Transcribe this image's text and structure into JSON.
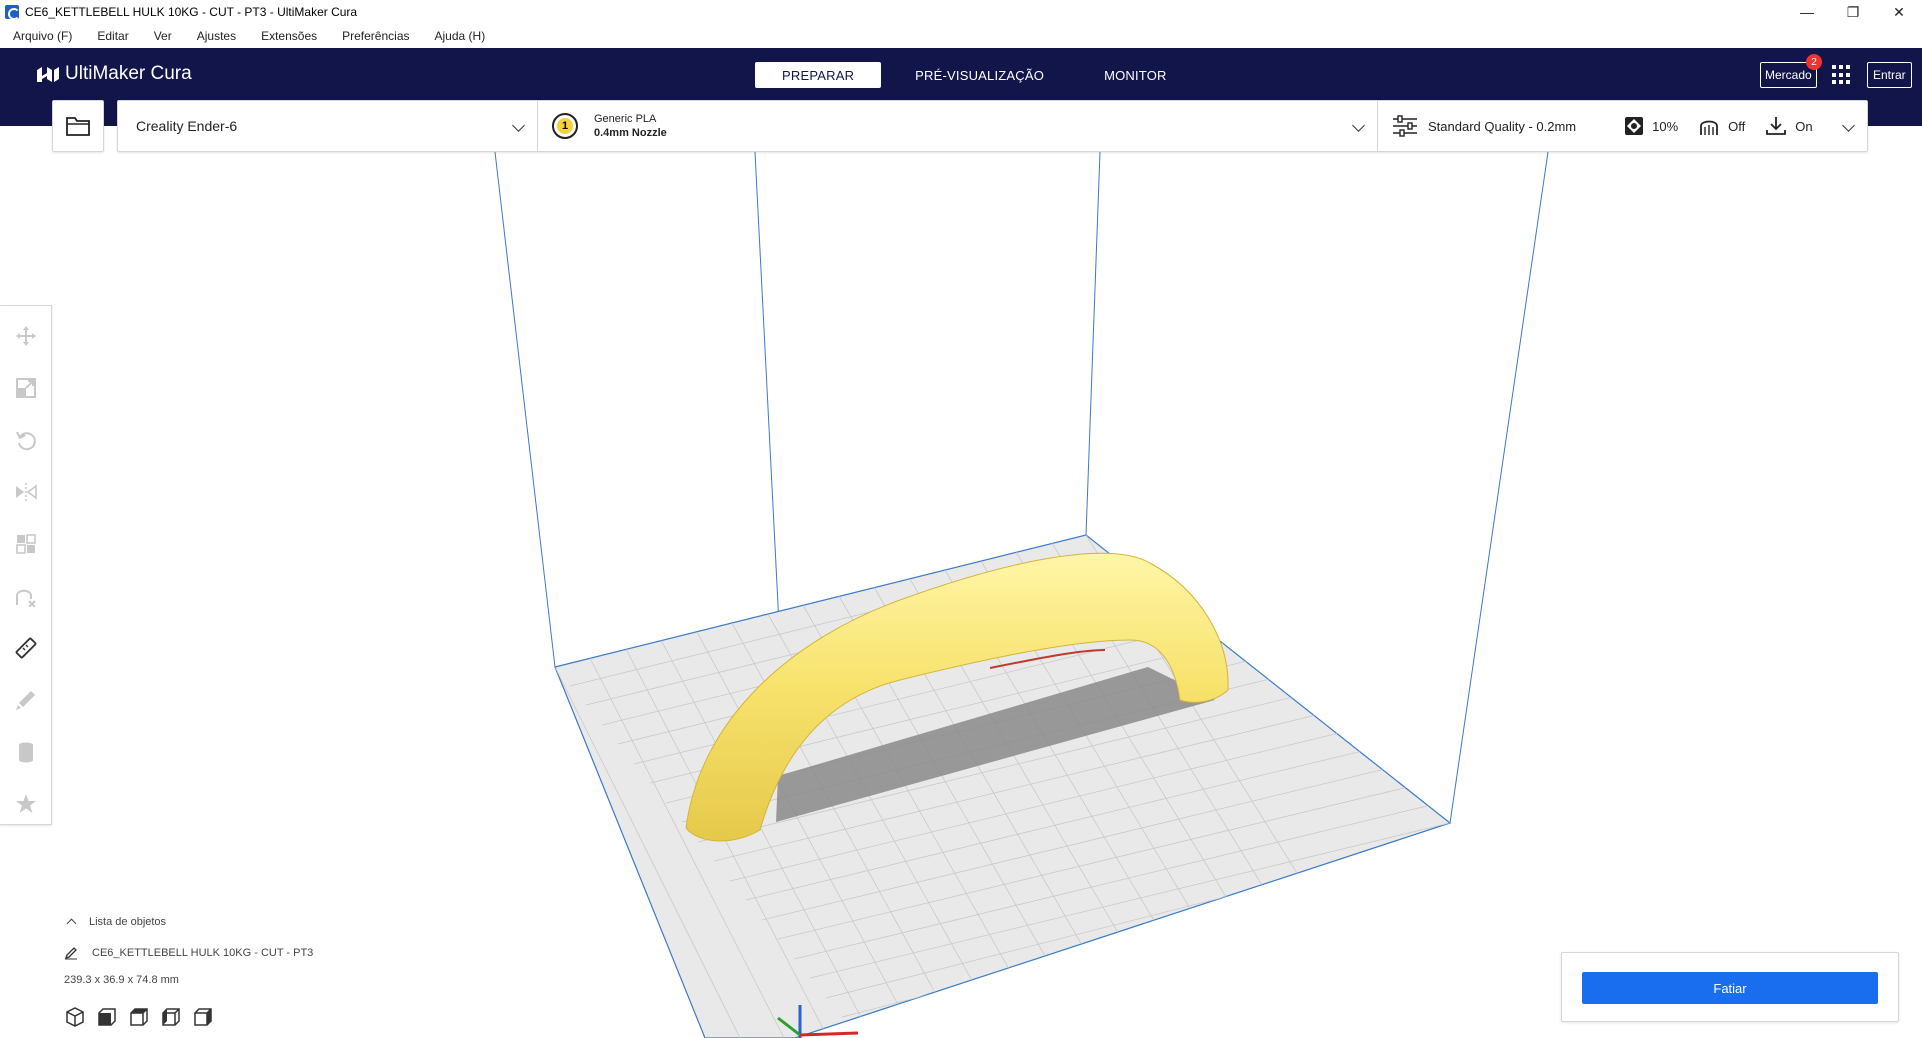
{
  "window": {
    "title": "CE6_KETTLEBELL HULK 10KG - CUT - PT3 - UltiMaker Cura",
    "minimize": "—",
    "restore": "❐",
    "close": "✕"
  },
  "menu": [
    "Arquivo (F)",
    "Editar",
    "Ver",
    "Ajustes",
    "Extensões",
    "Preferências",
    "Ajuda (H)"
  ],
  "header": {
    "brand": "UltiMaker Cura",
    "tabs": [
      "PREPARAR",
      "PRÉ-VISUALIZAÇÃO",
      "MONITOR"
    ],
    "active_tab": "PREPARAR",
    "marketplace_label": "Mercado",
    "marketplace_badge": "2",
    "signin_label": "Entrar"
  },
  "config": {
    "printer": "Creality Ender-6",
    "extruder_number": "1",
    "material": "Generic PLA",
    "nozzle": "0.4mm Nozzle",
    "quality": "Standard Quality - 0.2mm",
    "infill": "10%",
    "support": "Off",
    "adhesion": "On"
  },
  "object_list": {
    "title": "Lista de objetos",
    "object_name": "CE6_KETTLEBELL HULK 10KG - CUT - PT3",
    "dimensions": "239.3 x 36.9 x 74.8 mm"
  },
  "slice": {
    "button_label": "Fatiar"
  },
  "colors": {
    "header_bg": "#11154a",
    "slice_button": "#196ef0",
    "model": "#f8e36e",
    "build_plate": "#e9e9e9"
  },
  "icons": {
    "tools": [
      "move-icon",
      "scale-icon",
      "rotate-icon",
      "mirror-icon",
      "per-model-settings-icon",
      "support-blocker-icon",
      "measure-icon",
      "paint-icon",
      "cylinder-icon",
      "star-icon"
    ],
    "view_cubes": [
      "3d-view-icon",
      "front-view-icon",
      "top-view-icon",
      "left-view-icon",
      "right-view-icon"
    ]
  }
}
